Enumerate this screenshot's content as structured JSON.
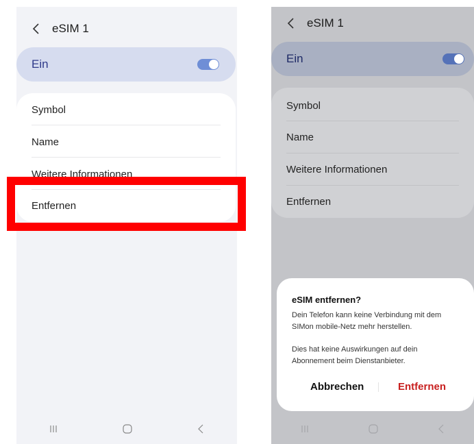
{
  "left": {
    "header": {
      "title": "eSIM 1"
    },
    "toggle": {
      "label": "Ein",
      "state": "on"
    },
    "menu": {
      "items": [
        "Symbol",
        "Name",
        "Weitere Informationen",
        "Entfernen"
      ]
    },
    "highlight_color": "#ff0000"
  },
  "right": {
    "header": {
      "title": "eSIM 1"
    },
    "toggle": {
      "label": "Ein",
      "state": "on"
    },
    "menu": {
      "items": [
        "Symbol",
        "Name",
        "Weitere Informationen",
        "Entfernen"
      ]
    },
    "dialog": {
      "title": "eSIM entfernen?",
      "body_line1": "Dein Telefon kann keine Verbindung mit dem",
      "body_line2": "SIMon mobile-Netz mehr herstellen.",
      "body_line3": "Dies hat keine Auswirkungen auf dein",
      "body_line4": "Abonnement beim Dienstanbieter.",
      "cancel_label": "Abbrechen",
      "confirm_label": "Entfernen",
      "confirm_color": "#c8201f"
    }
  },
  "nav_icons": [
    "recent-apps-icon",
    "home-icon",
    "back-icon"
  ]
}
